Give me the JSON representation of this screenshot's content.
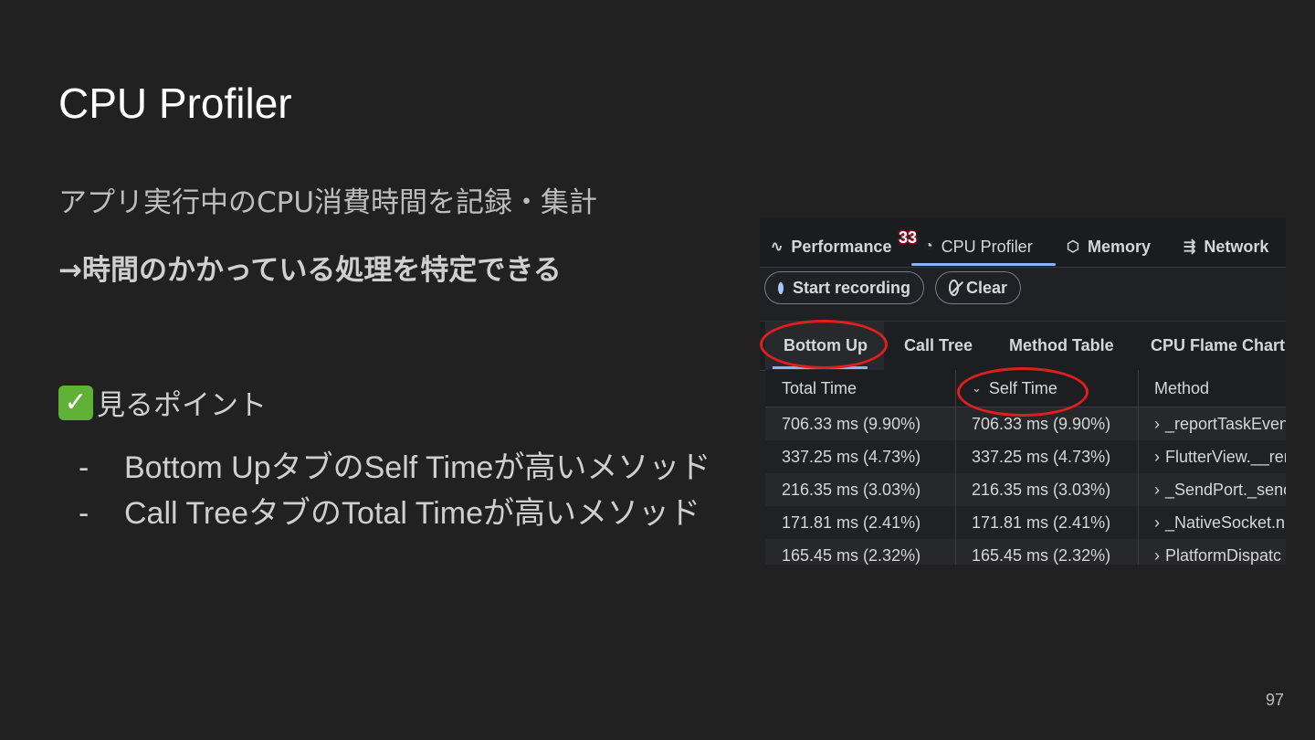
{
  "slide": {
    "title": "CPU Profiler",
    "subtitle": "アプリ実行中のCPU消費時間を記録・集計",
    "highlight": "→時間のかかっている処理を特定できる",
    "points_heading": "見るポイント",
    "points_icon": "check-mark-button-icon",
    "bullets": [
      {
        "dash": "-",
        "text": "Bottom UpタブのSelf Timeが高いメソッド"
      },
      {
        "dash": "-",
        "text": "Call TreeタブのTotal Timeが高いメソッド"
      }
    ],
    "page_number": "97"
  },
  "profiler": {
    "tabs": {
      "performance": "Performance",
      "cpu_profiler": "CPU Profiler",
      "memory": "Memory",
      "network": "Network"
    },
    "badge": "33",
    "buttons": {
      "start_recording": "Start recording",
      "clear": "Clear"
    },
    "subtabs": {
      "bottom_up": "Bottom Up",
      "call_tree": "Call Tree",
      "method_table": "Method Table",
      "cpu_flame_chart": "CPU Flame Chart"
    },
    "columns": {
      "total_time": "Total Time",
      "self_time": "Self Time",
      "method": "Method"
    },
    "rows": [
      {
        "total": "706.33 ms (9.90%)",
        "self": "706.33 ms (9.90%)",
        "method": "_reportTaskEven"
      },
      {
        "total": "337.25 ms (4.73%)",
        "self": "337.25 ms (4.73%)",
        "method": "FlutterView.__rer"
      },
      {
        "total": "216.35 ms (3.03%)",
        "self": "216.35 ms (3.03%)",
        "method": "_SendPort._senc"
      },
      {
        "total": "171.81 ms (2.41%)",
        "self": "171.81 ms (2.41%)",
        "method": "_NativeSocket.n"
      },
      {
        "total": "165.45 ms (2.32%)",
        "self": "165.45 ms (2.32%)",
        "method": "PlatformDispatc"
      }
    ],
    "colors": {
      "accent": "#8ab4f8",
      "annotation_ring": "#e01e1e",
      "badge": "#b00020"
    }
  }
}
